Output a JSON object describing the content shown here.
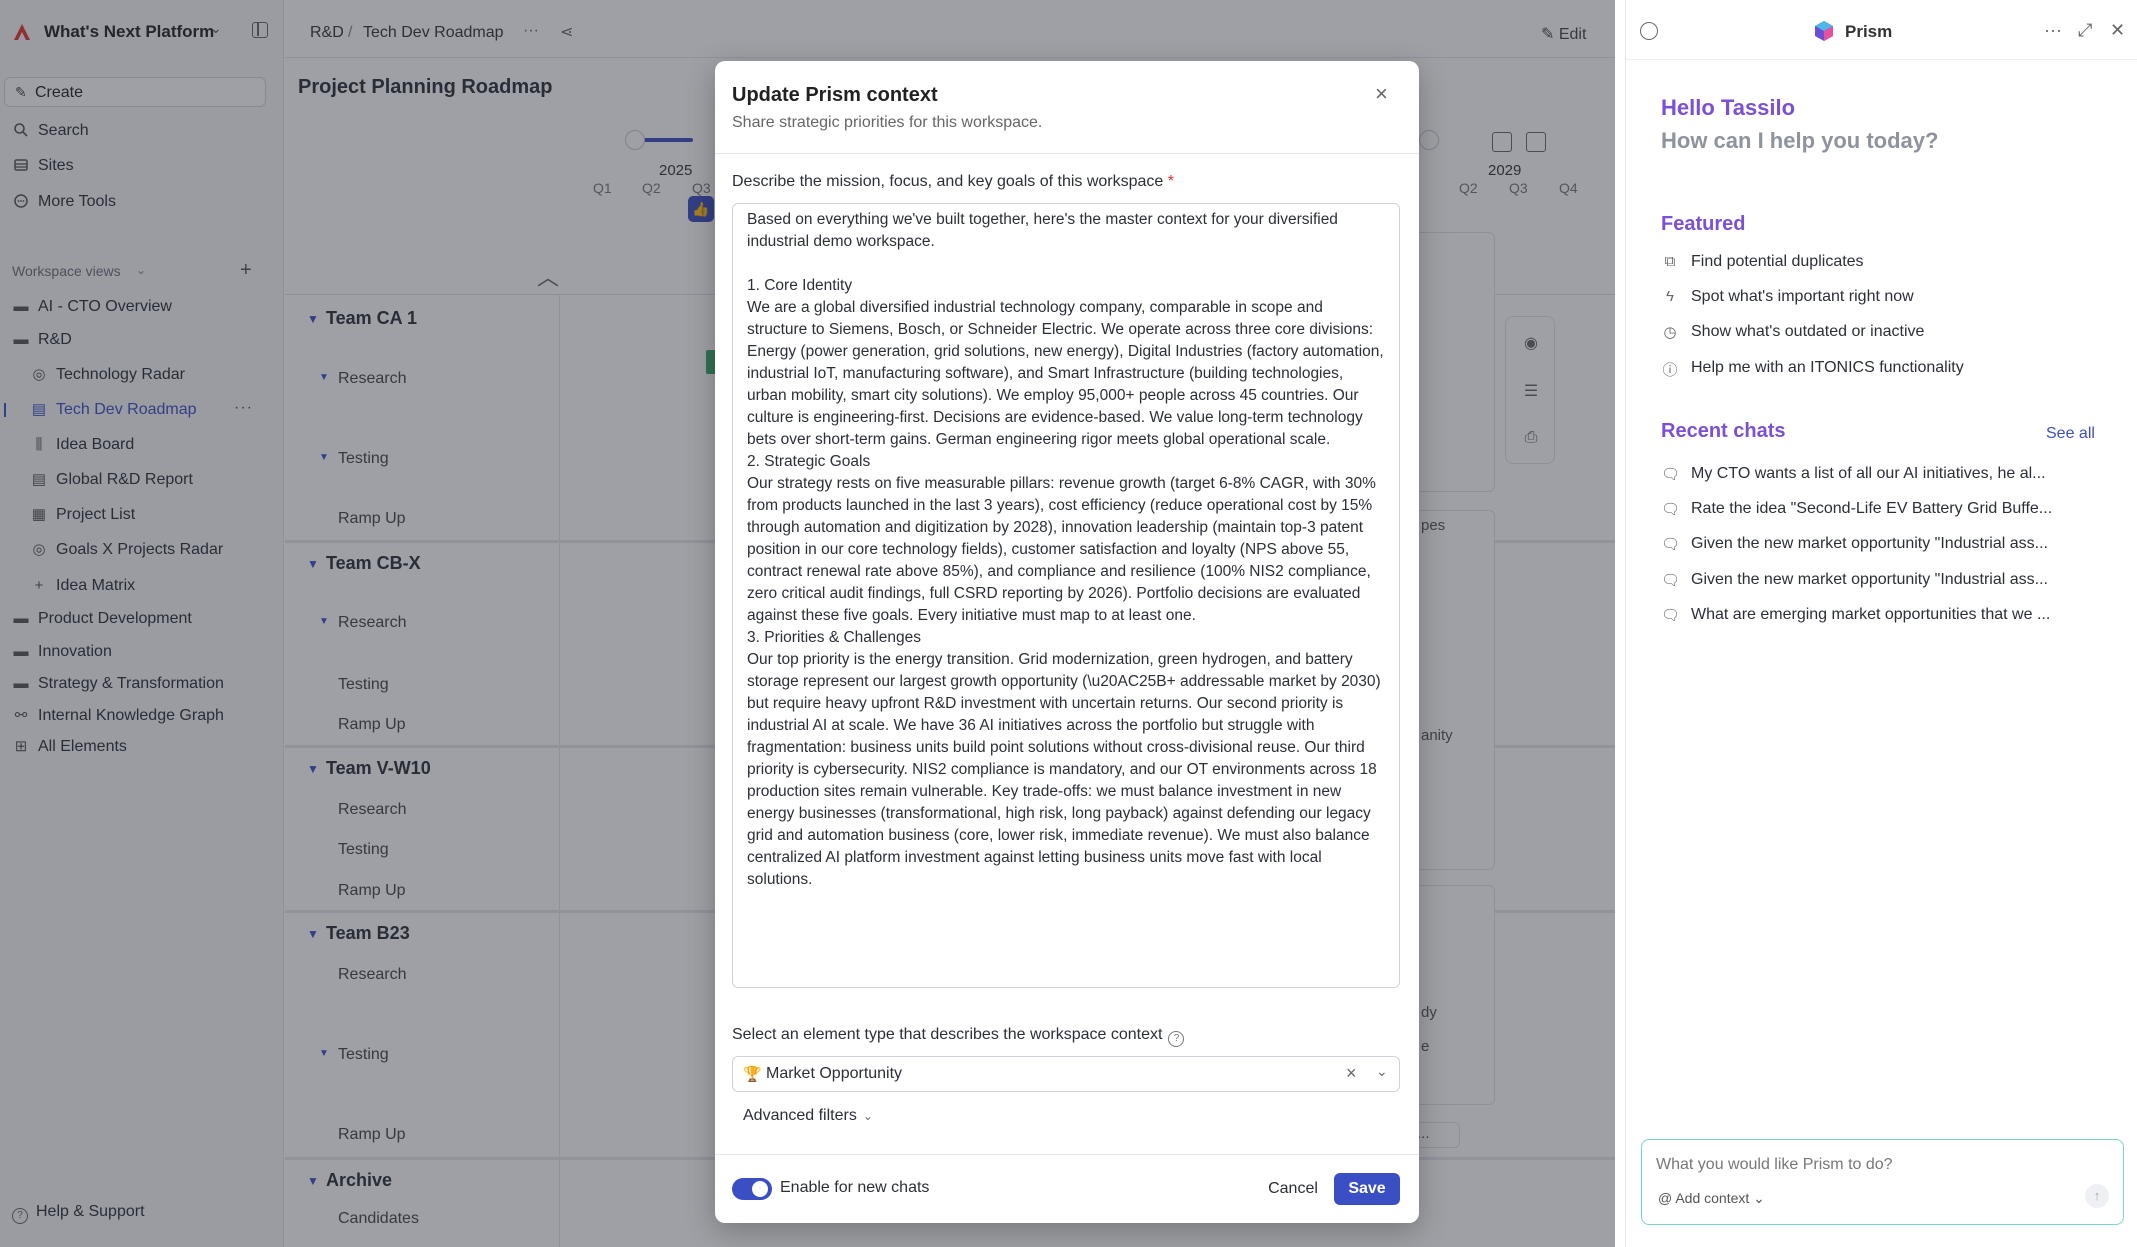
{
  "sidebar": {
    "org_name": "What's Next Platform",
    "create_label": "Create",
    "nav": [
      {
        "label": "Search",
        "icon": "search-icon"
      },
      {
        "label": "Sites",
        "icon": "sites-icon"
      },
      {
        "label": "More Tools",
        "icon": "more-tools-icon"
      }
    ],
    "workspace_views_label": "Workspace views",
    "tree": [
      {
        "label": "AI - CTO Overview",
        "icon": "folder-icon"
      },
      {
        "label": "R&D",
        "icon": "folder-icon"
      },
      {
        "label": "Technology Radar",
        "icon": "radar-icon"
      },
      {
        "label": "Tech Dev Roadmap",
        "icon": "roadmap-icon",
        "active": true
      },
      {
        "label": "Idea Board",
        "icon": "board-icon"
      },
      {
        "label": "Global R&D Report",
        "icon": "report-icon"
      },
      {
        "label": "Project List",
        "icon": "list-icon"
      },
      {
        "label": "Goals X Projects Radar",
        "icon": "radar-icon"
      },
      {
        "label": "Idea Matrix",
        "icon": "matrix-icon"
      },
      {
        "label": "Product Development",
        "icon": "folder-icon"
      },
      {
        "label": "Innovation",
        "icon": "folder-icon"
      },
      {
        "label": "Strategy & Transformation",
        "icon": "folder-icon"
      },
      {
        "label": "Internal Knowledge Graph",
        "icon": "graph-icon"
      },
      {
        "label": "All Elements",
        "icon": "grid-icon"
      }
    ],
    "help_label": "Help & Support"
  },
  "main": {
    "breadcrumb": [
      "R&D",
      "/",
      "Tech Dev Roadmap"
    ],
    "edit_label": "Edit",
    "title": "Project Planning Roadmap",
    "timeline": {
      "years": [
        "2025",
        "2029"
      ],
      "quarters_left": [
        "Q1",
        "Q2",
        "Q3"
      ],
      "quarters_right": [
        "Q2",
        "Q3",
        "Q4"
      ]
    },
    "teams": [
      {
        "name": "Team CA 1",
        "lanes": [
          "Research",
          "Testing",
          "Ramp Up"
        ]
      },
      {
        "name": "Team CB-X",
        "lanes": [
          "Research",
          "Testing",
          "Ramp Up"
        ]
      },
      {
        "name": "Team V-W10",
        "lanes": [
          "Research",
          "Testing",
          "Ramp Up"
        ]
      },
      {
        "name": "Team B23",
        "lanes": [
          "Research",
          "Testing",
          "Ramp Up"
        ]
      },
      {
        "name": "Archive",
        "lanes": [
          "Candidates"
        ]
      }
    ],
    "peek_text": [
      "pes",
      "anity",
      "dy",
      "e",
      "..."
    ]
  },
  "prism": {
    "name": "Prism",
    "greeting": "Hello Tassilo",
    "subgreeting": "How can I help you today?",
    "featured_title": "Featured",
    "featured": [
      {
        "label": "Find potential duplicates",
        "icon": "duplicates-icon"
      },
      {
        "label": "Spot what's important right now",
        "icon": "lightning-icon"
      },
      {
        "label": "Show what's outdated or inactive",
        "icon": "clock-icon"
      },
      {
        "label": "Help me with an ITONICS functionality",
        "icon": "help-icon"
      }
    ],
    "recent_title": "Recent chats",
    "see_all": "See all",
    "recent": [
      "My CTO wants a list of all our AI initiatives, he al...",
      "Rate the idea \"Second-Life EV Battery Grid Buffe...",
      "Given the new market opportunity \"Industrial ass...",
      "Given the new market opportunity \"Industrial ass...",
      "What are emerging market opportunities that we ..."
    ],
    "input_placeholder": "What you would like Prism to do?",
    "add_context": "Add context"
  },
  "modal": {
    "title": "Update Prism context",
    "subtitle": "Share strategic priorities for this workspace.",
    "field_label": "Describe the mission, focus, and key goals of this workspace",
    "required_mark": "*",
    "context_text": "Based on everything we've built together, here's the master context for your diversified industrial demo workspace.\n\n1. Core Identity\nWe are a global diversified industrial technology company, comparable in scope and structure to Siemens, Bosch, or Schneider Electric. We operate across three core divisions: Energy (power generation, grid solutions, new energy), Digital Industries (factory automation, industrial IoT, manufacturing software), and Smart Infrastructure (building technologies, urban mobility, smart city solutions). We employ 95,000+ people across 45 countries. Our culture is engineering-first. Decisions are evidence-based. We value long-term technology bets over short-term gains. German engineering rigor meets global operational scale.\n2. Strategic Goals\nOur strategy rests on five measurable pillars: revenue growth (target 6-8% CAGR, with 30% from products launched in the last 3 years), cost efficiency (reduce operational cost by 15% through automation and digitization by 2028), innovation leadership (maintain top-3 patent position in our core technology fields), customer satisfaction and loyalty (NPS above 55, contract renewal rate above 85%), and compliance and resilience (100% NIS2 compliance, zero critical audit findings, full CSRD reporting by 2026). Portfolio decisions are evaluated against these five goals. Every initiative must map to at least one.\n3. Priorities & Challenges\nOur top priority is the energy transition. Grid modernization, green hydrogen, and battery storage represent our largest growth opportunity (\\u20AC25B+ addressable market by 2030) but require heavy upfront R&D investment with uncertain returns. Our second priority is industrial AI at scale. We have 36 AI initiatives across the portfolio but struggle with fragmentation: business units build point solutions without cross-divisional reuse. Our third priority is cybersecurity. NIS2 compliance is mandatory, and our OT environments across 18 production sites remain vulnerable. Key trade-offs: we must balance investment in new energy businesses (transformational, high risk, long payback) against defending our legacy grid and automation business (core, lower risk, immediate revenue). We must also balance centralized AI platform investment against letting business units move fast with local solutions.",
    "select_label": "Select an element type that describes the workspace context",
    "select_value": "Market Opportunity",
    "advanced_filters": "Advanced filters",
    "toggle_label": "Enable for new chats",
    "toggle_on": true,
    "cancel_label": "Cancel",
    "save_label": "Save",
    "accent_color": "#3b4fc4"
  }
}
